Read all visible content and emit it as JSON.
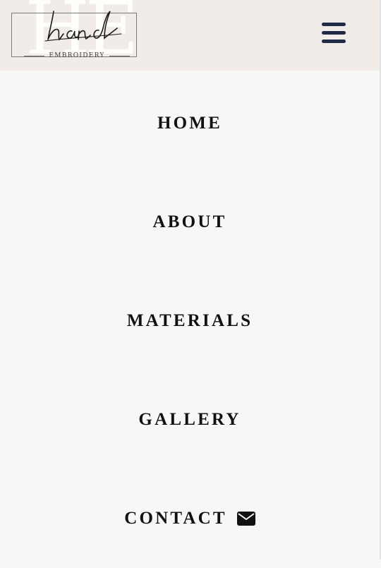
{
  "header": {
    "logo": {
      "monogram": "HE",
      "script": "hand",
      "subtitle": "EMBROIDERY"
    },
    "menu_icon": "hamburger-menu-icon"
  },
  "nav": {
    "items": [
      {
        "label": "HOME"
      },
      {
        "label": "ABOUT"
      },
      {
        "label": "MATERIALS"
      },
      {
        "label": "GALLERY"
      },
      {
        "label": "CONTACT",
        "icon": "envelope-icon"
      }
    ]
  },
  "colors": {
    "header_bg": "#f2ece9",
    "page_bg": "#f7f7f5",
    "menu_icon": "#1e2a47",
    "nav_text": "#111111"
  }
}
